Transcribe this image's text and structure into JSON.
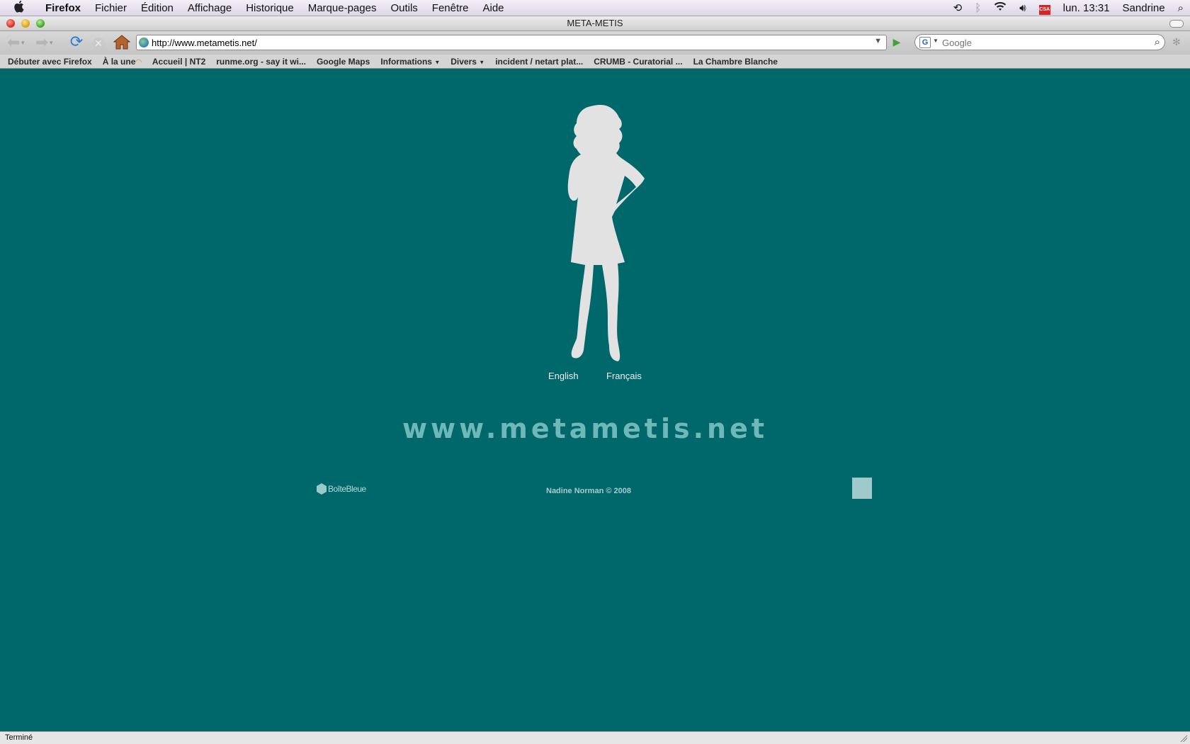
{
  "menubar": {
    "app_name": "Firefox",
    "menus": [
      "Fichier",
      "Édition",
      "Affichage",
      "Historique",
      "Marque-pages",
      "Outils",
      "Fenêtre",
      "Aide"
    ],
    "flag_label": "CSA",
    "clock": "lun. 13:31",
    "user": "Sandrine"
  },
  "window": {
    "title": "META-METIS"
  },
  "toolbar": {
    "url": "http://www.metametis.net/",
    "search_engine": "Google",
    "search_placeholder": "Google",
    "search_engine_letter": "G"
  },
  "bookmarks": [
    {
      "label": "Débuter avec Firefox"
    },
    {
      "label": "À la une",
      "icon": "rss-icon"
    },
    {
      "label": "Accueil | NT2"
    },
    {
      "label": "runme.org - say it wi..."
    },
    {
      "label": "Google Maps"
    },
    {
      "label": "Informations",
      "folder": true
    },
    {
      "label": "Divers",
      "folder": true
    },
    {
      "label": "incident / netart plat..."
    },
    {
      "label": "CRUMB - Curatorial ..."
    },
    {
      "label": "La Chambre Blanche"
    }
  ],
  "page": {
    "lang_english": "English",
    "lang_french": "Français",
    "site_title": "www.metametis.net",
    "copyright": "Nadine Norman © 2008",
    "left_logo_text": "BoîteBleue",
    "background_color": "#00686a",
    "silhouette_color": "#e2e2e2"
  },
  "status": {
    "text": "Terminé"
  }
}
